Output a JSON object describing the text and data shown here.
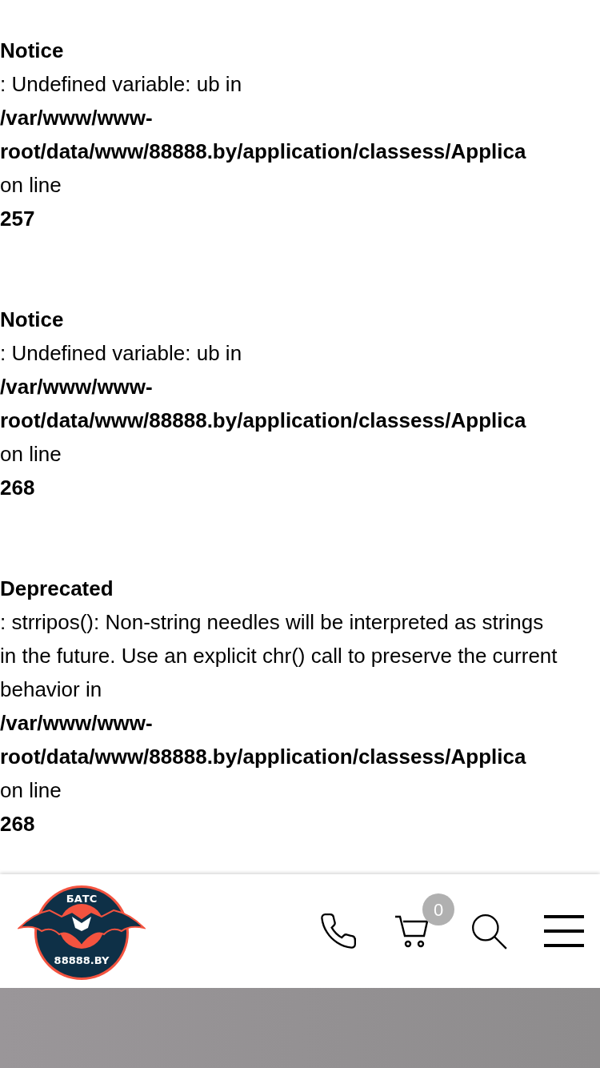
{
  "messages": [
    {
      "level": "Notice",
      "message": ": Undefined variable: ub in",
      "path_lines": [
        "/var/www/www-",
        "root/data/www/88888.by/application/classess/Applica"
      ],
      "on_line": "on line",
      "line": "257"
    },
    {
      "level": "Notice",
      "message": ": Undefined variable: ub in",
      "path_lines": [
        "/var/www/www-",
        "root/data/www/88888.by/application/classess/Applica"
      ],
      "on_line": "on line",
      "line": "268"
    },
    {
      "level": "Deprecated",
      "message": ": strripos(): Non-string needles will be interpreted as strings in the future. Use an explicit chr() call to preserve the current behavior in",
      "path_lines": [
        "/var/www/www-",
        "root/data/www/88888.by/application/classess/Applica"
      ],
      "on_line": "on line",
      "line": "268"
    }
  ],
  "header": {
    "logo": {
      "top": "БАТС",
      "bottom": "88888.BY"
    },
    "cart_count": "0"
  }
}
